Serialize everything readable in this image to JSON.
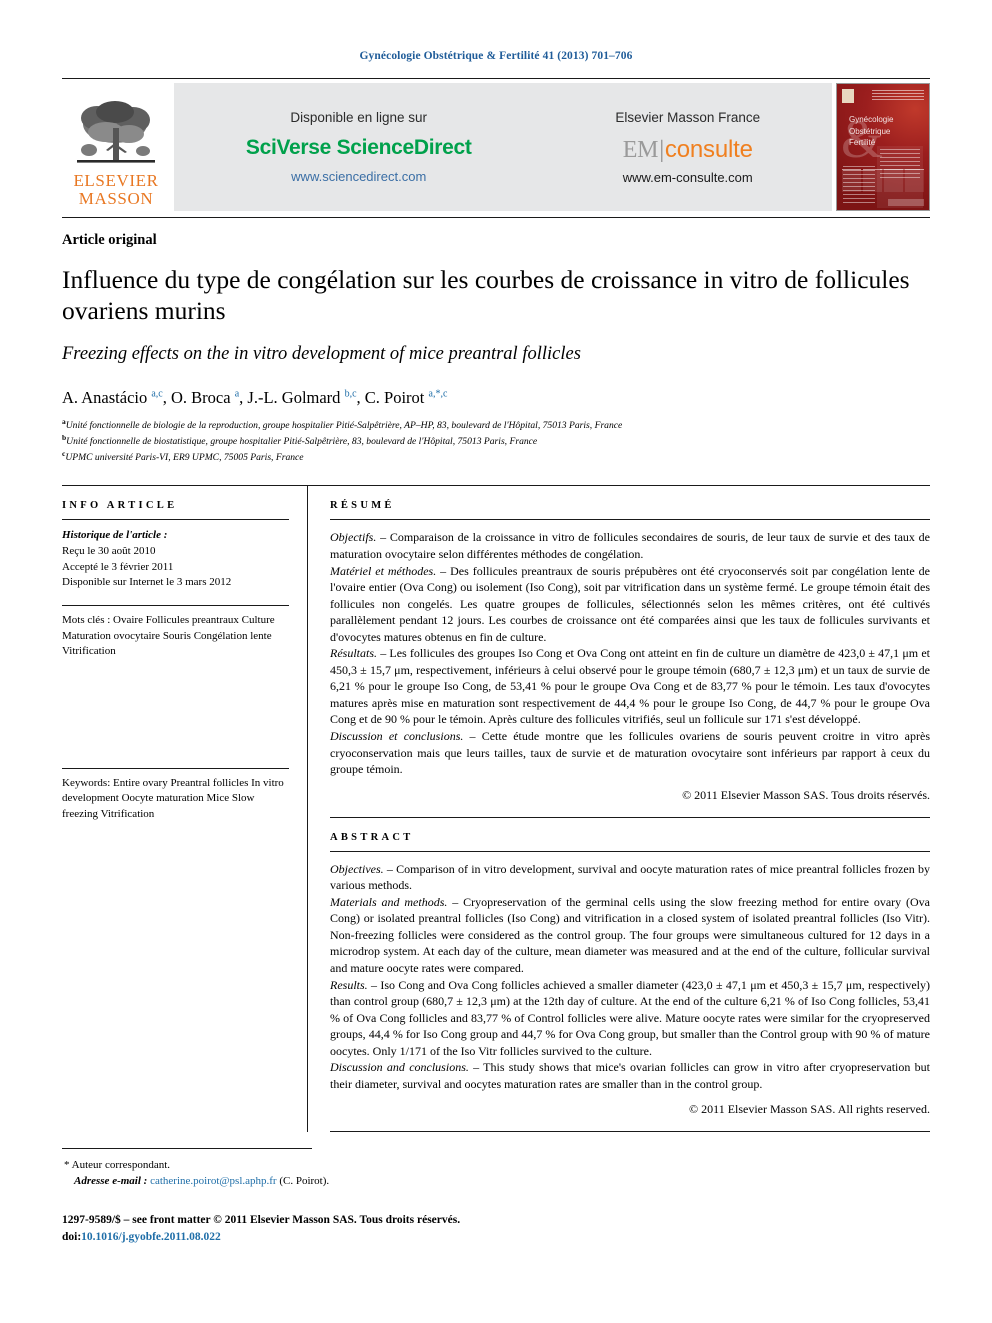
{
  "running_head": "Gynécologie Obstétrique & Fertilité 41 (2013) 701–706",
  "masthead": {
    "publisher_logo_line1": "ELSEVIER",
    "publisher_logo_line2": "MASSON",
    "left_block": {
      "top_label": "Disponible en ligne sur",
      "brand": "SciVerse ScienceDirect",
      "url": "www.sciencedirect.com"
    },
    "right_block": {
      "top_label": "Elsevier Masson France",
      "brand_part1": "EM",
      "brand_part2": "consulte",
      "url": "www.em-consulte.com"
    },
    "cover_title_line1": "Gynécologie",
    "cover_title_line2": "Obstétrique",
    "cover_title_line3": "Fertilité"
  },
  "article": {
    "type": "Article original",
    "title_fr": "Influence du type de congélation sur les courbes de croissance in vitro de follicules ovariens murins",
    "title_en": "Freezing effects on the in vitro development of mice preantral follicles",
    "authors_html": "A. Anastácio <sup>a,c</sup>, O. Broca <sup>a</sup>, J.-L. Golmard <sup>b,c</sup>, C. Poirot <sup>a,*,c</sup>",
    "affiliations": [
      "Unité fonctionnelle de biologie de la reproduction, groupe hospitalier Pitié-Salpêtrière, AP–HP, 83, boulevard de l'Hôpital, 75013 Paris, France",
      "Unité fonctionnelle de biostatistique, groupe hospitalier Pitié-Salpêtrière, 83, boulevard de l'Hôpital, 75013 Paris, France",
      "UPMC université Paris-VI, ER9 UPMC, 75005 Paris, France"
    ],
    "affil_markers": [
      "a",
      "b",
      "c"
    ]
  },
  "info_article": {
    "heading": "INFO ARTICLE",
    "history_label": "Historique de l'article :",
    "history": [
      "Reçu le 30 août 2010",
      "Accepté le 3 février 2011",
      "Disponible sur Internet le 3 mars 2012"
    ],
    "keywords_label": "Mots clés :",
    "keywords": [
      "Ovaire",
      "Follicules preantraux",
      "Culture",
      "Maturation ovocytaire",
      "Souris",
      "Congélation lente",
      "Vitrification"
    ]
  },
  "keywords_en": {
    "label": "Keywords:",
    "items": [
      "Entire ovary",
      "Preantral follicles",
      "In vitro development",
      "Oocyte maturation",
      "Mice",
      "Slow freezing",
      "Vitrification"
    ]
  },
  "resume": {
    "heading": "RÉSUMÉ",
    "paragraphs": [
      {
        "label": "Objectifs.",
        "text": " – Comparaison de la croissance in vitro de follicules secondaires de souris, de leur taux de survie et des taux de maturation ovocytaire selon différentes méthodes de congélation."
      },
      {
        "label": "Matériel et méthodes.",
        "text": " – Des follicules preantraux de souris prépubères ont été cryoconservés soit par congélation lente de l'ovaire entier (Ova Cong) ou isolement (Iso Cong), soit par vitrification dans un système fermé. Le groupe témoin était des follicules non congelés. Les quatre groupes de follicules, sélectionnés selon les mêmes critères, ont été cultivés parallèlement pendant 12 jours. Les courbes de croissance ont été comparées ainsi que les taux de follicules survivants et d'ovocytes matures obtenus en fin de culture."
      },
      {
        "label": "Résultats.",
        "text": " – Les follicules des groupes Iso Cong et Ova Cong ont atteint en fin de culture un diamètre de 423,0 ± 47,1 μm et 450,3 ± 15,7 μm, respectivement, inférieurs à celui observé pour le groupe témoin (680,7 ± 12,3 μm) et un taux de survie de 6,21 % pour le groupe Iso Cong, de 53,41 % pour le groupe Ova Cong et de 83,77 % pour le témoin. Les taux d'ovocytes matures après mise en maturation sont respectivement de 44,4 % pour le groupe Iso Cong, de 44,7 % pour le groupe Ova Cong et de 90 % pour le témoin. Après culture des follicules vitrifiés, seul un follicule sur 171 s'est développé."
      },
      {
        "label": "Discussion et conclusions.",
        "text": " – Cette étude montre que les follicules ovariens de souris peuvent croitre in vitro après cryoconservation mais que leurs tailles, taux de survie et de maturation ovocytaire sont inférieurs par rapport à ceux du groupe témoin."
      }
    ],
    "copyright": "© 2011 Elsevier Masson SAS. Tous droits réservés."
  },
  "abstract": {
    "heading": "ABSTRACT",
    "paragraphs": [
      {
        "label": "Objectives.",
        "text": " – Comparison of in vitro development, survival and oocyte maturation rates of mice preantral follicles frozen by various methods."
      },
      {
        "label": "Materials and methods.",
        "text": " – Cryopreservation of the germinal cells using the slow freezing method for entire ovary (Ova Cong) or isolated preantral follicles (Iso Cong) and vitrification in a closed system of isolated preantral follicles (Iso Vitr). Non-freezing follicles were considered as the control group. The four groups were simultaneous cultured for 12 days in a microdrop system. At each day of the culture, mean diameter was measured and at the end of the culture, follicular survival and mature oocyte rates were compared."
      },
      {
        "label": "Results.",
        "text": " – Iso Cong and Ova Cong follicles achieved a smaller diameter (423,0 ± 47,1 μm et 450,3 ± 15,7 μm, respectively) than control group (680,7 ± 12,3 μm) at the 12th day of culture. At the end of the culture 6,21 % of Iso Cong follicles, 53,41 % of Ova Cong follicles and 83,77 % of Control follicles were alive. Mature oocyte rates were similar for the cryopreserved groups, 44,4 % for Iso Cong group and 44,7 % for Ova Cong group, but smaller than the Control group with 90 % of mature oocytes. Only 1/171 of the Iso Vitr follicles survived to the culture."
      },
      {
        "label": "Discussion and conclusions.",
        "text": " – This study shows that mice's ovarian follicles can grow in vitro after cryopreservation but their diameter, survival and oocytes maturation rates are smaller than in the control group."
      }
    ],
    "copyright": "© 2011 Elsevier Masson SAS. All rights reserved."
  },
  "footnotes": {
    "corresponding_marker": "*",
    "corresponding_text": "Auteur correspondant.",
    "email_label": "Adresse e-mail :",
    "email": "catherine.poirot@psl.aphp.fr",
    "email_suffix": "(C. Poirot).",
    "issn_line": "1297-9589/$ – see front matter © 2011 Elsevier Masson SAS. Tous droits réservés.",
    "doi_label": "doi:",
    "doi": "10.1016/j.gyobfe.2011.08.022"
  },
  "colors": {
    "running_head": "#1f5c99",
    "sciverse_green": "#00a14b",
    "link_blue": "#1f6ea8",
    "elsevier_orange": "#e87722",
    "consulte_orange": "#f08020",
    "cover_red": "#9b1e1e",
    "band_gray": "#e6e7e8"
  }
}
